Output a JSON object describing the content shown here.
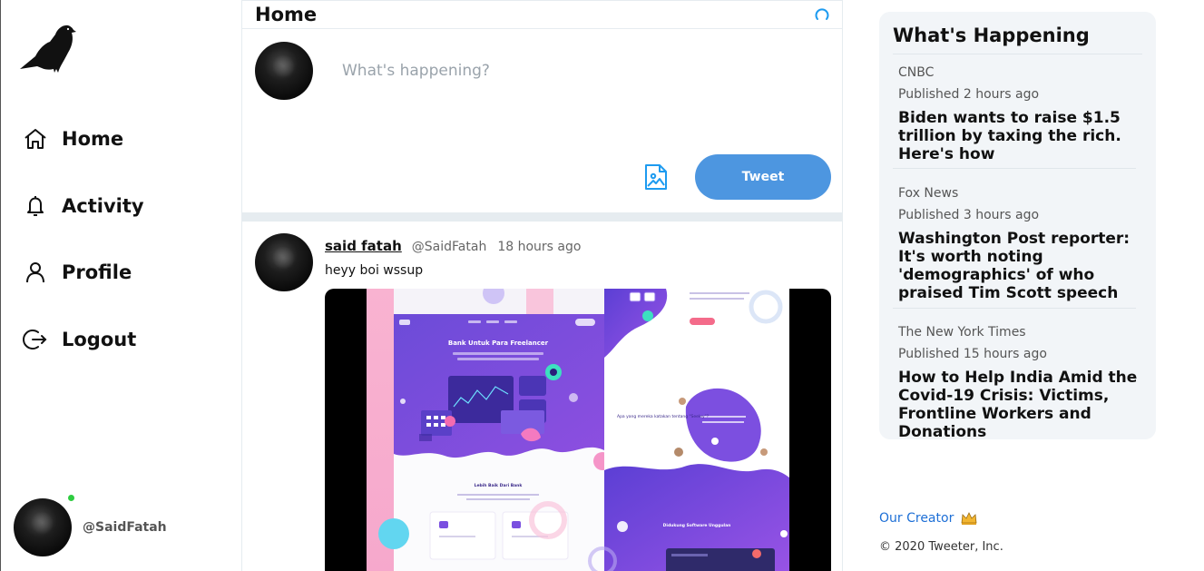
{
  "sidebar": {
    "nav": [
      {
        "label": "Home",
        "icon": "home-icon"
      },
      {
        "label": "Activity",
        "icon": "bell-icon"
      },
      {
        "label": "Profile",
        "icon": "user-icon"
      },
      {
        "label": "Logout",
        "icon": "logout-icon"
      }
    ],
    "user": {
      "handle": "@SaidFatah",
      "status": "online",
      "status_color": "#2ecc40"
    }
  },
  "main": {
    "title": "Home",
    "composer": {
      "placeholder": "What's happening?",
      "tweet_button_label": "Tweet"
    },
    "tweets": [
      {
        "name": "said fatah",
        "handle": "@SaidFatah",
        "time": "18 hours ago",
        "text": "heyy boi wssup",
        "media": {
          "heading": "Bank Untuk Para Freelancer",
          "subheading": "Lebih Baik Dari Bank",
          "section": "Didukung Software Unggulan",
          "question": "Apa yang mereka katakan tentang \"Seeley\"?"
        }
      }
    ]
  },
  "trends": {
    "title": "What's Happening",
    "items": [
      {
        "source": "CNBC",
        "published": "Published 2 hours ago",
        "headline": "Biden wants to raise $1.5 trillion by taxing the rich. Here's how"
      },
      {
        "source": "Fox News",
        "published": "Published 3 hours ago",
        "headline": "Washington Post reporter: It's worth noting 'demographics' of who praised Tim Scott speech"
      },
      {
        "source": "The New York Times",
        "published": "Published 15 hours ago",
        "headline": "How to Help India Amid the Covid-19 Crisis: Victims, Frontline Workers and Donations"
      }
    ]
  },
  "footer": {
    "creator_label": "Our Creator",
    "copyright": "© 2020 Tweeter, Inc."
  },
  "colors": {
    "accent": "#4d96e0",
    "link": "#1d6fd6",
    "panel": "#f2f5f8"
  }
}
